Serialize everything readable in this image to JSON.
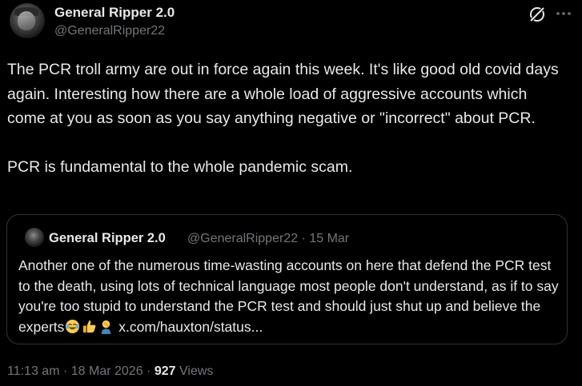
{
  "author": {
    "name": "General Ripper 2.0",
    "handle": "@GeneralRipper22"
  },
  "tweet": {
    "text": "The PCR troll army are out in force again this week. It's like good old covid days again. Interesting how there are a whole load of aggressive accounts which come at you as soon as you say anything negative or \"incorrect\" about PCR.\n\nPCR is fundamental to the whole pandemic scam."
  },
  "quote": {
    "name": "General Ripper 2.0",
    "handle": "@GeneralRipper22",
    "separator": "·",
    "date": "15 Mar",
    "text": "Another one of the numerous time-wasting accounts on here that defend the PCR test to the death, using lots of technical language most people don't understand, as if to say you're too stupid to understand the PCR test and should just shut up and believe the experts",
    "emojis": [
      "face-with-tears-of-joy-emoji",
      "thumbs-up-emoji",
      "person-facepalming-emoji"
    ],
    "link": "x.com/hauxton/status..."
  },
  "footer": {
    "time": "11:13 am",
    "separator1": "·",
    "date": "18 Mar 2026",
    "separator2": "·",
    "views_count": "927",
    "views_label": "Views"
  },
  "icons": {
    "grok": "grok-icon",
    "more": "more-options-icon"
  },
  "colors": {
    "background": "#000000",
    "text": "#e7e9ea",
    "muted": "#71767b",
    "border": "#2f3336"
  }
}
